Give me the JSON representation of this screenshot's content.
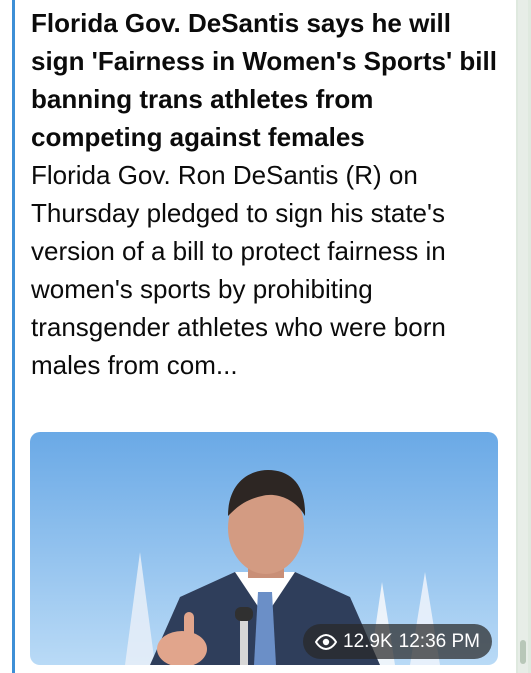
{
  "message": {
    "title": "Florida Gov. DeSantis says he will sign 'Fairness in Women's Sports' bill banning trans athletes from competing against females",
    "description": "Florida Gov. Ron DeSantis (R) on Thursday pledged to sign his state's version of a bill to protect fairness in women's sports by prohibiting transgender athletes who were born males from com...",
    "views": "12.9K",
    "time": "12:36 PM",
    "icons": {
      "views": "eye-icon"
    },
    "colors": {
      "accent_bar": "#3d8fd6",
      "sky": "#7fb7ea",
      "suit": "#2f3e5b",
      "tie": "#6b8fc7"
    }
  }
}
